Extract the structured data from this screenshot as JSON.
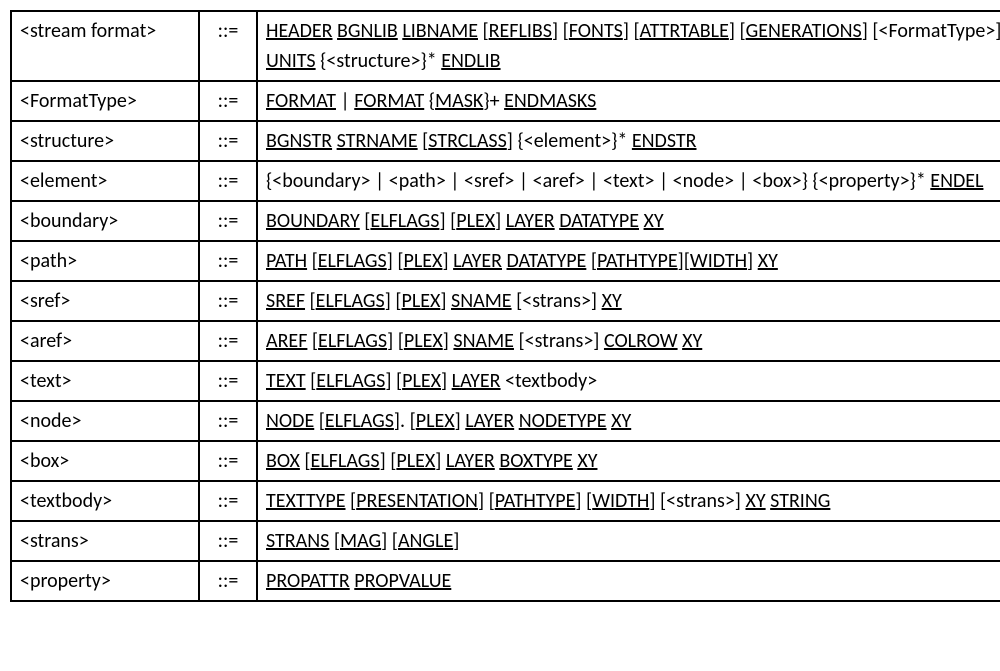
{
  "rows": [
    {
      "name": "<stream format>",
      "op": "::=",
      "def": "<span class='u'>HEADER</span> <span class='u'>BGNLIB</span> <span class='u'>LIBNAME</span> [<span class='u'>REFLIBS</span>] [<span class='u'>FONTS</span>] [<span class='u'>ATTRTABLE</span>] [<span class='u'>GENERATIONS</span>] [&lt;FormatType&gt;] <span class='u'>UNITS</span> {&lt;structure&gt;}* <span class='u'>ENDLIB</span>"
    },
    {
      "name": "<FormatType>",
      "op": "::=",
      "def": "<span class='u'>FORMAT</span> | <span class='u'>FORMAT</span> {<span class='u'>MASK</span>}+ <span class='u'>ENDMASKS</span>"
    },
    {
      "name": "<structure>",
      "op": "::=",
      "def": "<span class='u'>BGNSTR</span> <span class='u'>STRNAME</span> [<span class='u'>STRCLASS</span>] {&lt;element&gt;}* <span class='u'>ENDSTR</span>"
    },
    {
      "name": "<element>",
      "op": "::=",
      "def": "{&lt;boundary&gt; | &lt;path&gt; | &lt;sref&gt; | &lt;aref&gt; | &lt;text&gt; | &lt;node&gt; | &lt;box&gt;} {&lt;property&gt;}* <span class='u'>ENDEL</span>"
    },
    {
      "name": "<boundary>",
      "op": "::=",
      "def": "<span class='u'>BOUNDARY</span> [<span class='u'>ELFLAGS</span>] [<span class='u'>PLEX</span>] <span class='u'>LAYER</span> <span class='u'>DATATYPE</span> <span class='u'>XY</span>"
    },
    {
      "name": "<path>",
      "op": "::=",
      "def": "<span class='u'>PATH</span> [<span class='u'>ELFLAGS</span>] [<span class='u'>PLEX</span>] <span class='u'>LAYER</span> <span class='u'>DATATYPE</span> [<span class='u'>PATHTYPE</span>][<span class='u'>WIDTH</span>] <span class='u'>XY</span>"
    },
    {
      "name": "<sref>",
      "op": "::=",
      "def": "<span class='u'>SREF</span> [<span class='u'>ELFLAGS</span>] [<span class='u'>PLEX</span>] <span class='u'>SNAME</span> [&lt;strans&gt;] <span class='u'>XY</span>"
    },
    {
      "name": "<aref>",
      "op": "::=",
      "def": "<span class='u'>AREF</span> [<span class='u'>ELFLAGS</span>] [<span class='u'>PLEX</span>] <span class='u'>SNAME</span> [&lt;strans&gt;] <span class='u'>COLROW</span> <span class='u'>XY</span>"
    },
    {
      "name": "<text>",
      "op": "::=",
      "def": "<span class='u'>TEXT</span> [<span class='u'>ELFLAGS</span>] [<span class='u'>PLEX</span>] <span class='u'>LAYER</span> &lt;textbody&gt;"
    },
    {
      "name": "<node>",
      "op": "::=",
      "def": "<span class='u'>NODE</span> [<span class='u'>ELFLAGS</span>]. [<span class='u'>PLEX</span>] <span class='u'>LAYER</span> <span class='u'>NODETYPE</span> <span class='u'>XY</span>"
    },
    {
      "name": "<box>",
      "op": "::=",
      "def": "<span class='u'>BOX</span> [<span class='u'>ELFLAGS</span>] [<span class='u'>PLEX</span>] <span class='u'>LAYER</span> <span class='u'>BOXTYPE</span> <span class='u'>XY</span>"
    },
    {
      "name": "<textbody>",
      "op": "::=",
      "def": "<span class='u'>TEXTTYPE</span> [<span class='u'>PRESENTATION</span>] [<span class='u'>PATHTYPE</span>] [<span class='u'>WIDTH</span>] [&lt;strans&gt;] <span class='u'>XY</span> <span class='u'>STRING</span>"
    },
    {
      "name": "<strans>",
      "op": "::=",
      "def": "<span class='u'>STRANS</span> [<span class='u'>MAG</span>] [<span class='u'>ANGLE</span>]"
    },
    {
      "name": "<property>",
      "op": "::=",
      "def": "<span class='u'>PROPATTR</span> <span class='u'>PROPVALUE</span>"
    }
  ]
}
